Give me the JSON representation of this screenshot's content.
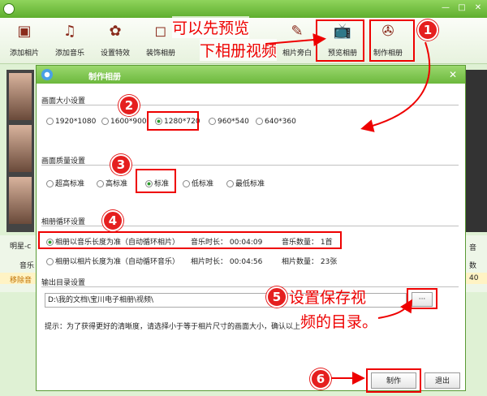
{
  "window": {
    "minimize": "—",
    "maximize": "□",
    "close": "✕"
  },
  "toolbar": {
    "items": [
      {
        "label": "添加相片",
        "icon": "image-icon"
      },
      {
        "label": "添加音乐",
        "icon": "music-note-icon"
      },
      {
        "label": "设置特效",
        "icon": "palette-icon"
      },
      {
        "label": "装饰相册",
        "icon": "frame-icon"
      },
      {
        "label": "相片旁白",
        "icon": "edit-icon"
      },
      {
        "label": "预览相册",
        "icon": "tv-icon"
      },
      {
        "label": "制作相册",
        "icon": "film-reel-icon"
      }
    ]
  },
  "background": {
    "bright_label": "明星-c",
    "music_label": "音乐",
    "remove_label": "移除音",
    "right_fragment_1": "音",
    "right_fragment_2": "数",
    "right_fragment_3": "40"
  },
  "dialog": {
    "title": "制作相册",
    "close": "✕",
    "size_section": "画面大小设置",
    "size_options": [
      "1920*1080",
      "1600*900",
      "1280*720",
      "960*540",
      "640*360"
    ],
    "size_selected": "1280*720",
    "quality_section": "画面质量设置",
    "quality_options": [
      "超高标准",
      "高标准",
      "标准",
      "低标准",
      "最低标准"
    ],
    "quality_selected": "标准",
    "loop_section": "相册循环设置",
    "loop_opt1": "相册以音乐长度为准（自动循环相片）",
    "music_duration_label": "音乐时长：",
    "music_duration": "00:04:09",
    "music_count_label": "音乐数量：",
    "music_count": "1首",
    "loop_opt2": "相册以相片长度为准（自动循环音乐）",
    "photo_duration_label": "相片时长：",
    "photo_duration": "00:04:56",
    "photo_count_label": "相片数量：",
    "photo_count": "23张",
    "output_section": "输出目录设置",
    "output_path": "D:\\我的文档\\宝川电子相册\\视频\\",
    "browse_label": "···",
    "tip": "提示：为了获得更好的清晰度，请选择小于等于相片尺寸的画面大小，确认以上",
    "make_button": "制作",
    "exit_button": "退出"
  },
  "annotations": {
    "preview_hint_1": "可以先预览",
    "preview_hint_2": "下相册视频",
    "dir_hint_1": "设置保存视",
    "dir_hint_2": "频的目录。",
    "numbers": [
      "1",
      "2",
      "3",
      "4",
      "5",
      "6"
    ],
    "color": "#e00000"
  }
}
